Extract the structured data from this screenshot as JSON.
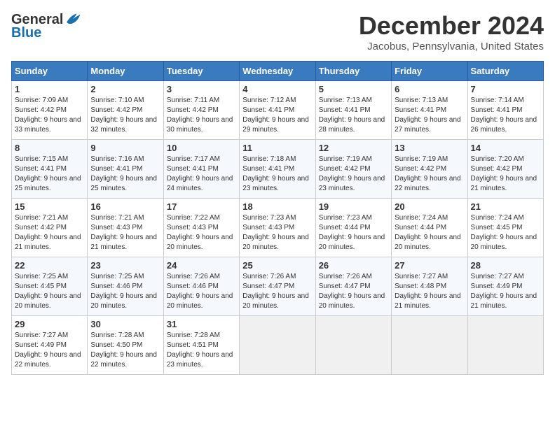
{
  "logo": {
    "general": "General",
    "blue": "Blue"
  },
  "title": "December 2024",
  "location": "Jacobus, Pennsylvania, United States",
  "headers": [
    "Sunday",
    "Monday",
    "Tuesday",
    "Wednesday",
    "Thursday",
    "Friday",
    "Saturday"
  ],
  "weeks": [
    [
      {
        "day": "1",
        "sunrise": "Sunrise: 7:09 AM",
        "sunset": "Sunset: 4:42 PM",
        "daylight": "Daylight: 9 hours and 33 minutes."
      },
      {
        "day": "2",
        "sunrise": "Sunrise: 7:10 AM",
        "sunset": "Sunset: 4:42 PM",
        "daylight": "Daylight: 9 hours and 32 minutes."
      },
      {
        "day": "3",
        "sunrise": "Sunrise: 7:11 AM",
        "sunset": "Sunset: 4:42 PM",
        "daylight": "Daylight: 9 hours and 30 minutes."
      },
      {
        "day": "4",
        "sunrise": "Sunrise: 7:12 AM",
        "sunset": "Sunset: 4:41 PM",
        "daylight": "Daylight: 9 hours and 29 minutes."
      },
      {
        "day": "5",
        "sunrise": "Sunrise: 7:13 AM",
        "sunset": "Sunset: 4:41 PM",
        "daylight": "Daylight: 9 hours and 28 minutes."
      },
      {
        "day": "6",
        "sunrise": "Sunrise: 7:13 AM",
        "sunset": "Sunset: 4:41 PM",
        "daylight": "Daylight: 9 hours and 27 minutes."
      },
      {
        "day": "7",
        "sunrise": "Sunrise: 7:14 AM",
        "sunset": "Sunset: 4:41 PM",
        "daylight": "Daylight: 9 hours and 26 minutes."
      }
    ],
    [
      {
        "day": "8",
        "sunrise": "Sunrise: 7:15 AM",
        "sunset": "Sunset: 4:41 PM",
        "daylight": "Daylight: 9 hours and 25 minutes."
      },
      {
        "day": "9",
        "sunrise": "Sunrise: 7:16 AM",
        "sunset": "Sunset: 4:41 PM",
        "daylight": "Daylight: 9 hours and 25 minutes."
      },
      {
        "day": "10",
        "sunrise": "Sunrise: 7:17 AM",
        "sunset": "Sunset: 4:41 PM",
        "daylight": "Daylight: 9 hours and 24 minutes."
      },
      {
        "day": "11",
        "sunrise": "Sunrise: 7:18 AM",
        "sunset": "Sunset: 4:41 PM",
        "daylight": "Daylight: 9 hours and 23 minutes."
      },
      {
        "day": "12",
        "sunrise": "Sunrise: 7:19 AM",
        "sunset": "Sunset: 4:42 PM",
        "daylight": "Daylight: 9 hours and 23 minutes."
      },
      {
        "day": "13",
        "sunrise": "Sunrise: 7:19 AM",
        "sunset": "Sunset: 4:42 PM",
        "daylight": "Daylight: 9 hours and 22 minutes."
      },
      {
        "day": "14",
        "sunrise": "Sunrise: 7:20 AM",
        "sunset": "Sunset: 4:42 PM",
        "daylight": "Daylight: 9 hours and 21 minutes."
      }
    ],
    [
      {
        "day": "15",
        "sunrise": "Sunrise: 7:21 AM",
        "sunset": "Sunset: 4:42 PM",
        "daylight": "Daylight: 9 hours and 21 minutes."
      },
      {
        "day": "16",
        "sunrise": "Sunrise: 7:21 AM",
        "sunset": "Sunset: 4:43 PM",
        "daylight": "Daylight: 9 hours and 21 minutes."
      },
      {
        "day": "17",
        "sunrise": "Sunrise: 7:22 AM",
        "sunset": "Sunset: 4:43 PM",
        "daylight": "Daylight: 9 hours and 20 minutes."
      },
      {
        "day": "18",
        "sunrise": "Sunrise: 7:23 AM",
        "sunset": "Sunset: 4:43 PM",
        "daylight": "Daylight: 9 hours and 20 minutes."
      },
      {
        "day": "19",
        "sunrise": "Sunrise: 7:23 AM",
        "sunset": "Sunset: 4:44 PM",
        "daylight": "Daylight: 9 hours and 20 minutes."
      },
      {
        "day": "20",
        "sunrise": "Sunrise: 7:24 AM",
        "sunset": "Sunset: 4:44 PM",
        "daylight": "Daylight: 9 hours and 20 minutes."
      },
      {
        "day": "21",
        "sunrise": "Sunrise: 7:24 AM",
        "sunset": "Sunset: 4:45 PM",
        "daylight": "Daylight: 9 hours and 20 minutes."
      }
    ],
    [
      {
        "day": "22",
        "sunrise": "Sunrise: 7:25 AM",
        "sunset": "Sunset: 4:45 PM",
        "daylight": "Daylight: 9 hours and 20 minutes."
      },
      {
        "day": "23",
        "sunrise": "Sunrise: 7:25 AM",
        "sunset": "Sunset: 4:46 PM",
        "daylight": "Daylight: 9 hours and 20 minutes."
      },
      {
        "day": "24",
        "sunrise": "Sunrise: 7:26 AM",
        "sunset": "Sunset: 4:46 PM",
        "daylight": "Daylight: 9 hours and 20 minutes."
      },
      {
        "day": "25",
        "sunrise": "Sunrise: 7:26 AM",
        "sunset": "Sunset: 4:47 PM",
        "daylight": "Daylight: 9 hours and 20 minutes."
      },
      {
        "day": "26",
        "sunrise": "Sunrise: 7:26 AM",
        "sunset": "Sunset: 4:47 PM",
        "daylight": "Daylight: 9 hours and 20 minutes."
      },
      {
        "day": "27",
        "sunrise": "Sunrise: 7:27 AM",
        "sunset": "Sunset: 4:48 PM",
        "daylight": "Daylight: 9 hours and 21 minutes."
      },
      {
        "day": "28",
        "sunrise": "Sunrise: 7:27 AM",
        "sunset": "Sunset: 4:49 PM",
        "daylight": "Daylight: 9 hours and 21 minutes."
      }
    ],
    [
      {
        "day": "29",
        "sunrise": "Sunrise: 7:27 AM",
        "sunset": "Sunset: 4:49 PM",
        "daylight": "Daylight: 9 hours and 22 minutes."
      },
      {
        "day": "30",
        "sunrise": "Sunrise: 7:28 AM",
        "sunset": "Sunset: 4:50 PM",
        "daylight": "Daylight: 9 hours and 22 minutes."
      },
      {
        "day": "31",
        "sunrise": "Sunrise: 7:28 AM",
        "sunset": "Sunset: 4:51 PM",
        "daylight": "Daylight: 9 hours and 23 minutes."
      },
      null,
      null,
      null,
      null
    ]
  ]
}
